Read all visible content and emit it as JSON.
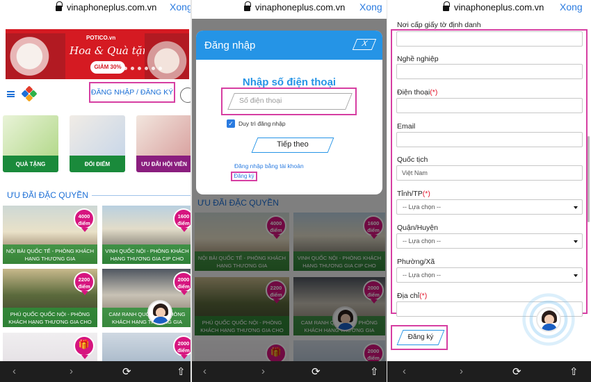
{
  "browser": {
    "url": "vinaphoneplus.com.vn",
    "done_label": "Xong"
  },
  "home": {
    "banner": {
      "brand": "POTICO.vn",
      "title": "Hoa & Quà tặng",
      "sale": "GIẢM 30%"
    },
    "login_register_label": "ĐĂNG NHẬP / ĐĂNG KÝ",
    "tiles": [
      {
        "label": "QUÀ TẶNG"
      },
      {
        "label": "ĐỔI ĐIỂM"
      },
      {
        "label": "ƯU ĐÃI HỘI VIÊN"
      }
    ],
    "section_title": "ƯU ĐÃI ĐẶC QUYỀN",
    "cards": [
      {
        "caption": "NỘI BÀI QUỐC TẾ - PHÒNG KHÁCH HẠNG THƯƠNG GIA",
        "points": "4000",
        "unit": "điểm"
      },
      {
        "caption": "VINH QUỐC NỘI - PHÒNG KHÁCH HẠNG THƯƠNG GIA CIP CHO",
        "points": "1600",
        "unit": "điểm"
      },
      {
        "caption": "PHÚ QUỐC QUỐC NỘI - PHÒNG KHÁCH HẠNG THƯƠNG GIA CHO",
        "points": "2200",
        "unit": "điểm"
      },
      {
        "caption": "CAM RANH QUỐC TẾ - PHÒNG KHÁCH HẠNG THƯƠNG GIA",
        "points": "2000",
        "unit": "điểm"
      },
      {
        "caption": "",
        "points": "",
        "unit": ""
      },
      {
        "caption": "",
        "points": "2000",
        "unit": "điểm"
      }
    ]
  },
  "login_modal": {
    "title": "Đăng nhập",
    "close_label": "X",
    "heading": "Nhập số điện thoại",
    "phone_placeholder": "Số điện thoại",
    "remember_label": "Duy trì đăng nhập",
    "remember_checked": true,
    "next_label": "Tiếp theo",
    "account_link": "Đăng nhập bằng tài khoản",
    "register_link": "Đăng ký"
  },
  "register_form": {
    "fields": [
      {
        "label": "Nơi cấp giấy tờ định danh",
        "required": false,
        "value": ""
      },
      {
        "label": "Nghề nghiệp",
        "required": false,
        "value": ""
      },
      {
        "label": "Điện thoại",
        "required": true,
        "value": ""
      },
      {
        "label": "Email",
        "required": false,
        "value": ""
      },
      {
        "label": "Quốc tịch",
        "required": false,
        "value": "Việt Nam"
      },
      {
        "label": "Tỉnh/TP",
        "required": true,
        "value": "-- Lựa chọn --"
      },
      {
        "label": "Quận/Huyện",
        "required": false,
        "value": "-- Lựa chọn --"
      },
      {
        "label": "Phường/Xã",
        "required": false,
        "value": "-- Lựa chọn --"
      },
      {
        "label": "Địa chỉ",
        "required": true,
        "value": ""
      }
    ],
    "required_mark": "(*)",
    "submit_label": "Đăng ký"
  }
}
